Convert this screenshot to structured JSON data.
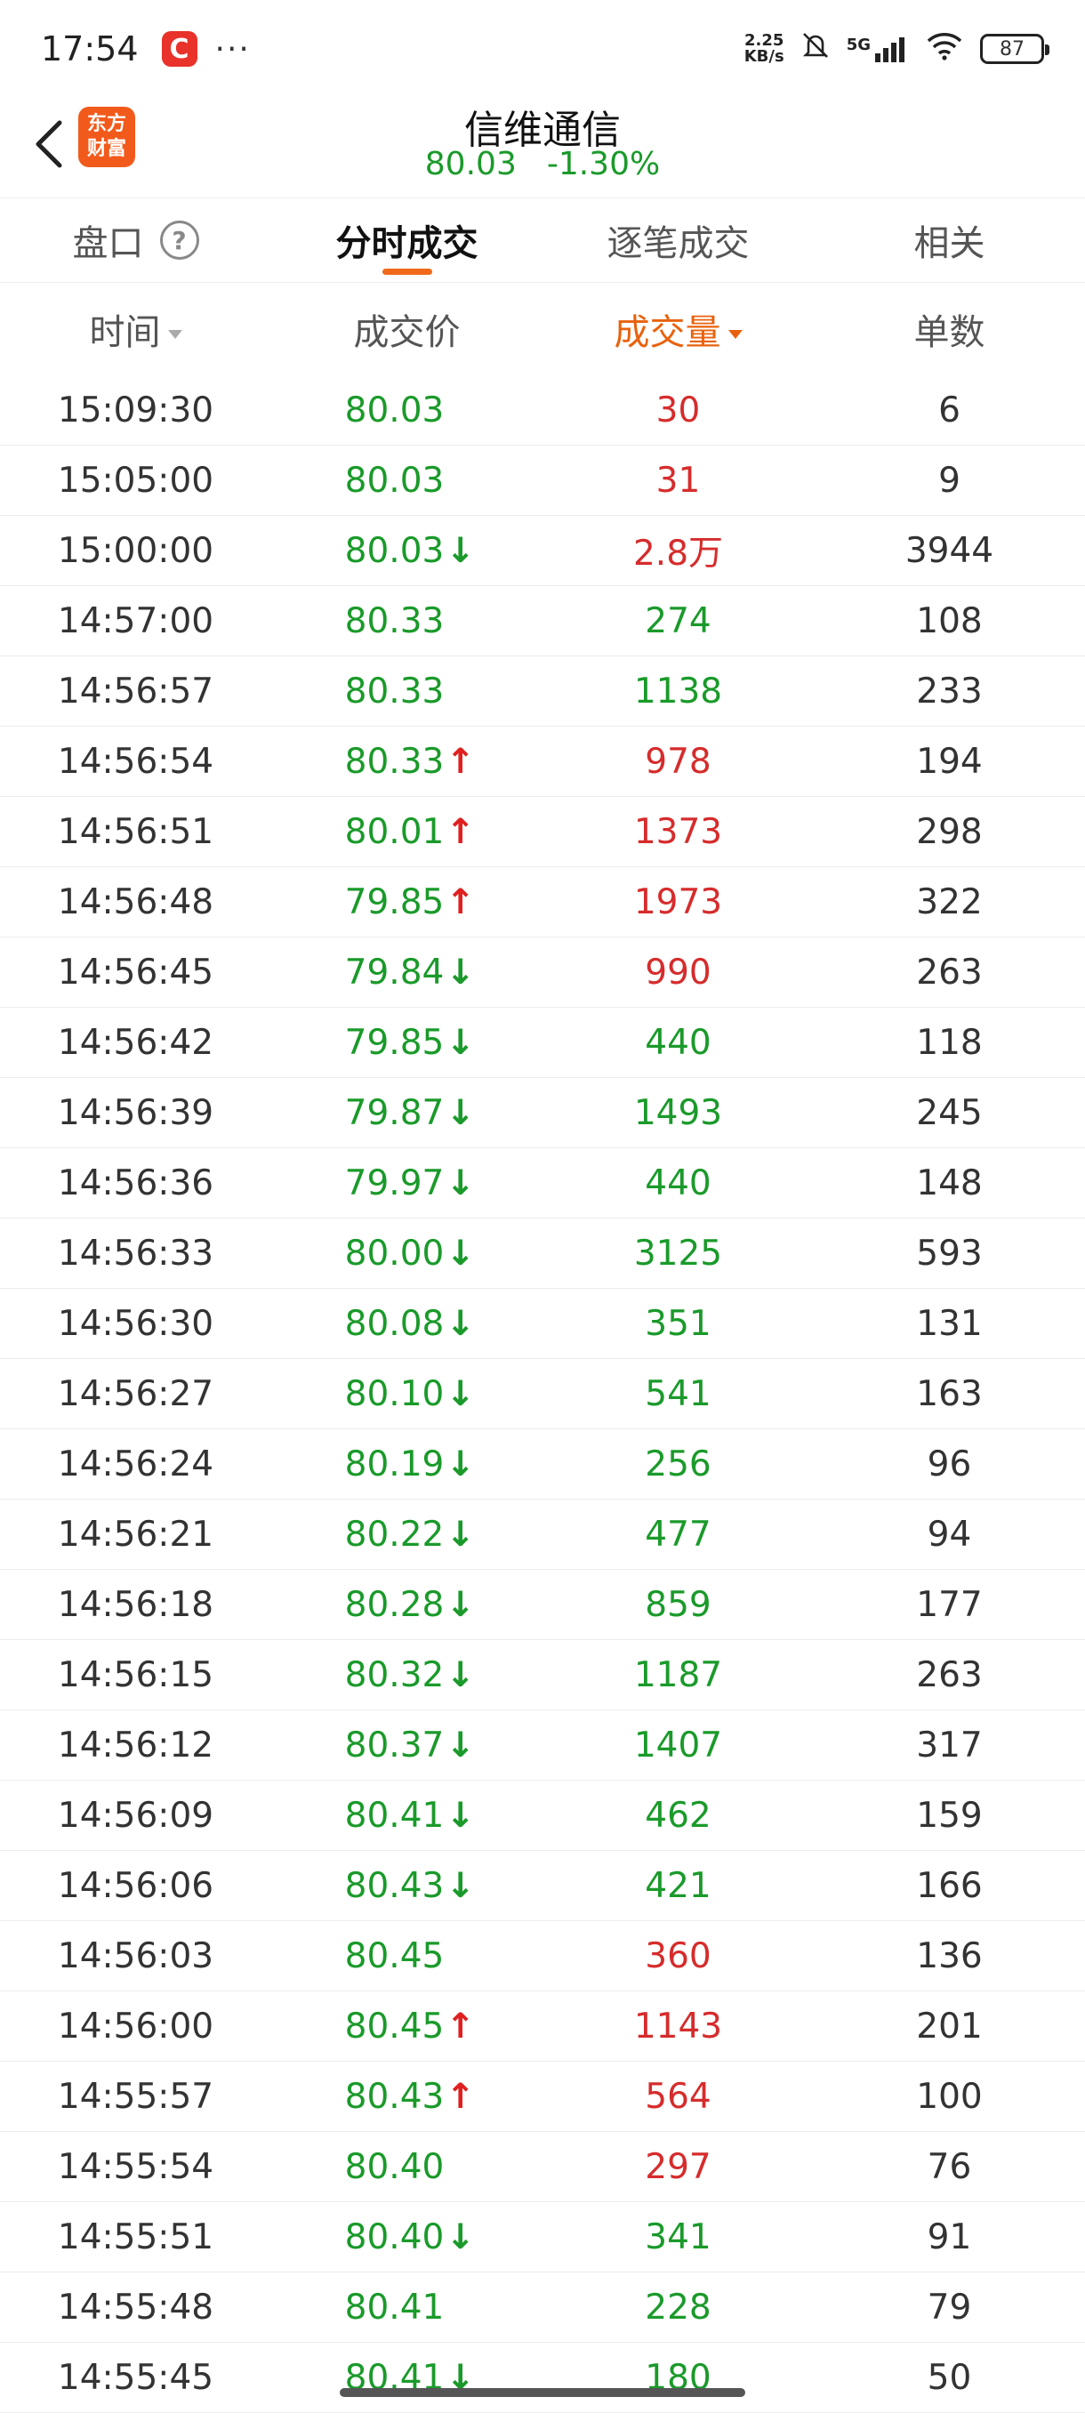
{
  "status_bar": {
    "time": "17:54",
    "app_icon": "C",
    "dots": "···",
    "net_speed_value": "2.25",
    "net_speed_unit": "KB/s",
    "signal": "5G",
    "battery": "87"
  },
  "header": {
    "logo_line1": "东方",
    "logo_line2": "财富",
    "stock_name": "信维通信",
    "price": "80.03",
    "change_pct": "-1.30%"
  },
  "tabs": [
    {
      "label": "盘口",
      "active": false
    },
    {
      "label": "分时成交",
      "active": true
    },
    {
      "label": "逐笔成交",
      "active": false
    },
    {
      "label": "相关",
      "active": false
    }
  ],
  "columns": {
    "time": "时间",
    "price": "成交价",
    "volume": "成交量",
    "count": "单数"
  },
  "colors": {
    "up": "#e02020",
    "down": "#1a9a2a",
    "accent": "#e8620e"
  },
  "trades": [
    {
      "time": "15:09:30",
      "price": "80.03",
      "arrow": "none",
      "volume": "30",
      "vol_color": "red",
      "count": "6"
    },
    {
      "time": "15:05:00",
      "price": "80.03",
      "arrow": "none",
      "volume": "31",
      "vol_color": "red",
      "count": "9"
    },
    {
      "time": "15:00:00",
      "price": "80.03",
      "arrow": "down",
      "volume": "2.8万",
      "vol_color": "red",
      "count": "3944"
    },
    {
      "time": "14:57:00",
      "price": "80.33",
      "arrow": "none",
      "volume": "274",
      "vol_color": "green",
      "count": "108"
    },
    {
      "time": "14:56:57",
      "price": "80.33",
      "arrow": "none",
      "volume": "1138",
      "vol_color": "green",
      "count": "233"
    },
    {
      "time": "14:56:54",
      "price": "80.33",
      "arrow": "up",
      "volume": "978",
      "vol_color": "red",
      "count": "194"
    },
    {
      "time": "14:56:51",
      "price": "80.01",
      "arrow": "up",
      "volume": "1373",
      "vol_color": "red",
      "count": "298"
    },
    {
      "time": "14:56:48",
      "price": "79.85",
      "arrow": "up",
      "volume": "1973",
      "vol_color": "red",
      "count": "322"
    },
    {
      "time": "14:56:45",
      "price": "79.84",
      "arrow": "down",
      "volume": "990",
      "vol_color": "red",
      "count": "263"
    },
    {
      "time": "14:56:42",
      "price": "79.85",
      "arrow": "down",
      "volume": "440",
      "vol_color": "green",
      "count": "118"
    },
    {
      "time": "14:56:39",
      "price": "79.87",
      "arrow": "down",
      "volume": "1493",
      "vol_color": "green",
      "count": "245"
    },
    {
      "time": "14:56:36",
      "price": "79.97",
      "arrow": "down",
      "volume": "440",
      "vol_color": "green",
      "count": "148"
    },
    {
      "time": "14:56:33",
      "price": "80.00",
      "arrow": "down",
      "volume": "3125",
      "vol_color": "green",
      "count": "593"
    },
    {
      "time": "14:56:30",
      "price": "80.08",
      "arrow": "down",
      "volume": "351",
      "vol_color": "green",
      "count": "131"
    },
    {
      "time": "14:56:27",
      "price": "80.10",
      "arrow": "down",
      "volume": "541",
      "vol_color": "green",
      "count": "163"
    },
    {
      "time": "14:56:24",
      "price": "80.19",
      "arrow": "down",
      "volume": "256",
      "vol_color": "green",
      "count": "96"
    },
    {
      "time": "14:56:21",
      "price": "80.22",
      "arrow": "down",
      "volume": "477",
      "vol_color": "green",
      "count": "94"
    },
    {
      "time": "14:56:18",
      "price": "80.28",
      "arrow": "down",
      "volume": "859",
      "vol_color": "green",
      "count": "177"
    },
    {
      "time": "14:56:15",
      "price": "80.32",
      "arrow": "down",
      "volume": "1187",
      "vol_color": "green",
      "count": "263"
    },
    {
      "time": "14:56:12",
      "price": "80.37",
      "arrow": "down",
      "volume": "1407",
      "vol_color": "green",
      "count": "317"
    },
    {
      "time": "14:56:09",
      "price": "80.41",
      "arrow": "down",
      "volume": "462",
      "vol_color": "green",
      "count": "159"
    },
    {
      "time": "14:56:06",
      "price": "80.43",
      "arrow": "down",
      "volume": "421",
      "vol_color": "green",
      "count": "166"
    },
    {
      "time": "14:56:03",
      "price": "80.45",
      "arrow": "none",
      "volume": "360",
      "vol_color": "red",
      "count": "136"
    },
    {
      "time": "14:56:00",
      "price": "80.45",
      "arrow": "up",
      "volume": "1143",
      "vol_color": "red",
      "count": "201"
    },
    {
      "time": "14:55:57",
      "price": "80.43",
      "arrow": "up",
      "volume": "564",
      "vol_color": "red",
      "count": "100"
    },
    {
      "time": "14:55:54",
      "price": "80.40",
      "arrow": "none",
      "volume": "297",
      "vol_color": "red",
      "count": "76"
    },
    {
      "time": "14:55:51",
      "price": "80.40",
      "arrow": "down",
      "volume": "341",
      "vol_color": "green",
      "count": "91"
    },
    {
      "time": "14:55:48",
      "price": "80.41",
      "arrow": "none",
      "volume": "228",
      "vol_color": "green",
      "count": "79"
    },
    {
      "time": "14:55:45",
      "price": "80.41",
      "arrow": "down",
      "volume": "180",
      "vol_color": "green",
      "count": "50"
    }
  ]
}
